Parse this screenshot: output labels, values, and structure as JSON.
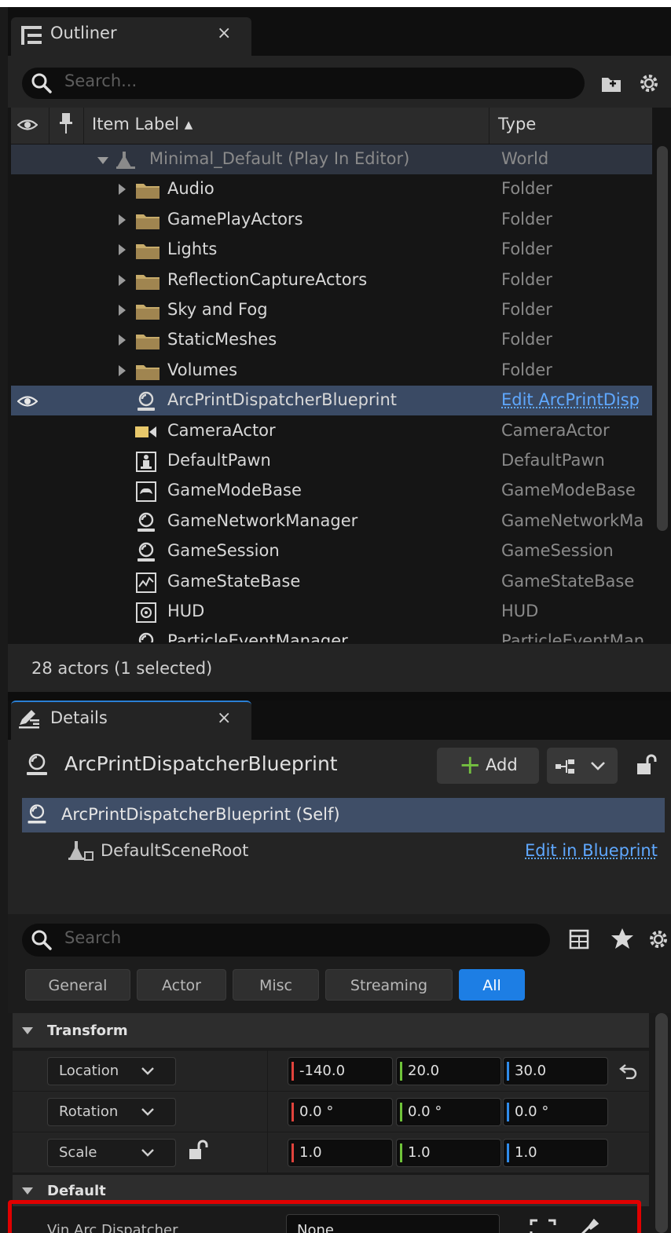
{
  "outliner": {
    "tab_title": "Outliner",
    "close_glyph": "×",
    "search_placeholder": "Search...",
    "columns": {
      "label": "Item Label ▴",
      "type": "Type"
    },
    "rows": [
      {
        "label": "Minimal_Default (Play In Editor)",
        "type": "World",
        "kind": "world",
        "icon": "world-icon"
      },
      {
        "label": "Audio",
        "type": "Folder",
        "kind": "folder",
        "icon": "folder-icon"
      },
      {
        "label": "GamePlayActors",
        "type": "Folder",
        "kind": "folder",
        "icon": "folder-icon"
      },
      {
        "label": "Lights",
        "type": "Folder",
        "kind": "folder",
        "icon": "folder-icon"
      },
      {
        "label": "ReflectionCaptureActors",
        "type": "Folder",
        "kind": "folder",
        "icon": "folder-icon"
      },
      {
        "label": "Sky and Fog",
        "type": "Folder",
        "kind": "folder",
        "icon": "folder-icon"
      },
      {
        "label": "StaticMeshes",
        "type": "Folder",
        "kind": "folder",
        "icon": "folder-icon"
      },
      {
        "label": "Volumes",
        "type": "Folder",
        "kind": "folder",
        "icon": "folder-icon"
      },
      {
        "label": "ArcPrintDispatcherBlueprint",
        "type": "Edit ArcPrintDisp",
        "kind": "selected",
        "icon": "actor-icon"
      },
      {
        "label": "CameraActor",
        "type": "CameraActor",
        "kind": "actor",
        "icon": "camera-icon"
      },
      {
        "label": "DefaultPawn",
        "type": "DefaultPawn",
        "kind": "actor",
        "icon": "pawn-icon"
      },
      {
        "label": "GameModeBase",
        "type": "GameModeBase",
        "kind": "actor",
        "icon": "gamemode-icon"
      },
      {
        "label": "GameNetworkManager",
        "type": "GameNetworkMa",
        "kind": "actor",
        "icon": "actor-icon"
      },
      {
        "label": "GameSession",
        "type": "GameSession",
        "kind": "actor",
        "icon": "actor-icon"
      },
      {
        "label": "GameStateBase",
        "type": "GameStateBase",
        "kind": "actor",
        "icon": "gamestate-icon"
      },
      {
        "label": "HUD",
        "type": "HUD",
        "kind": "actor",
        "icon": "hud-icon"
      },
      {
        "label": "ParticleEventManager",
        "type": "ParticleEventMan",
        "kind": "actor",
        "icon": "actor-icon"
      }
    ],
    "status": "28 actors (1 selected)"
  },
  "details": {
    "tab_title": "Details",
    "close_glyph": "×",
    "actor_title": "ArcPrintDispatcherBlueprint",
    "add_label": "Add",
    "add_plus": "+",
    "self_component": "ArcPrintDispatcherBlueprint (Self)",
    "root_component": "DefaultSceneRoot",
    "edit_in_blueprint": "Edit in Blueprint",
    "search_placeholder": "Search",
    "filters": [
      "General",
      "Actor",
      "Misc",
      "Streaming",
      "All"
    ],
    "active_filter": "All",
    "sections": {
      "transform": "Transform",
      "default": "Default"
    },
    "transform": {
      "location": {
        "label": "Location",
        "x": "-140.0",
        "y": "20.0",
        "z": "30.0"
      },
      "rotation": {
        "label": "Rotation",
        "x": "0.0 °",
        "y": "0.0 °",
        "z": "0.0 °"
      },
      "scale": {
        "label": "Scale",
        "x": "1.0",
        "y": "1.0",
        "z": "1.0"
      }
    },
    "var": {
      "label": "Vin Arc Dispatcher",
      "value": "None"
    }
  },
  "colors": {
    "x_axis": "#e0433c",
    "y_axis": "#6fc33a",
    "z_axis": "#2f8bea",
    "link": "#5fa8ff",
    "highlight": "#e00000",
    "active_filter": "#1d7ee4"
  }
}
